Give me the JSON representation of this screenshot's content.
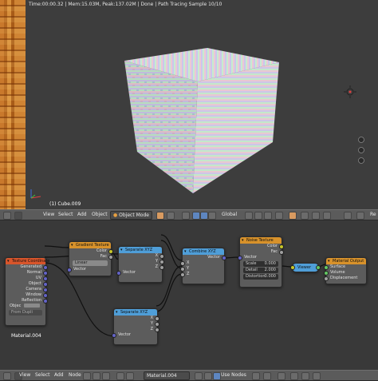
{
  "viewport": {
    "status": "Time:00:00.32 | Mem:15.03M, Peak:137.02M | Done | Path Tracing Sample 10/10",
    "object_name": "(1) Cube.009"
  },
  "viewport_header": {
    "menu_view": "View",
    "menu_select": "Select",
    "menu_add": "Add",
    "menu_object": "Object",
    "mode": "Object Mode",
    "orientation": "Global",
    "truncated": "Re"
  },
  "node_editor": {
    "material_label": "Material.004",
    "nodes": {
      "texcoord": {
        "title": "Texture Coordinate",
        "outputs": [
          "Generated",
          "Normal",
          "UV",
          "Object",
          "Camera",
          "Window",
          "Reflection"
        ],
        "object_label": "Objec",
        "from_dupli": "From Dupli"
      },
      "gradient": {
        "title": "Gradient Texture",
        "outputs": [
          "Color",
          "Fac"
        ],
        "type": "Linear",
        "input": "Vector"
      },
      "separate1": {
        "title": "Separate XYZ",
        "outputs": [
          "X",
          "Y",
          "Z"
        ],
        "input": "Vector"
      },
      "separate2": {
        "title": "Separate XYZ",
        "outputs": [
          "X",
          "Y",
          "Z"
        ],
        "input": "Vector"
      },
      "combine": {
        "title": "Combine XYZ",
        "output": "Vector",
        "inputs": [
          "X",
          "Y",
          "Z"
        ]
      },
      "noise": {
        "title": "Noise Texture",
        "outputs": [
          "Color",
          "Fac"
        ],
        "input": "Vector",
        "scale_label": "Scale",
        "scale_value": "0.000",
        "detail_label": "Detail",
        "detail_value": "2.000",
        "distortion_label": "Distortion",
        "distortion_value": "0.000"
      },
      "viewer": {
        "title": "Viewer"
      },
      "output": {
        "title": "Material Output",
        "inputs": [
          "Surface",
          "Volume",
          "Displacement"
        ]
      }
    }
  },
  "node_header": {
    "menu_view": "View",
    "menu_select": "Select",
    "menu_add": "Add",
    "menu_node": "Node",
    "material": "Material.004",
    "use_nodes": "Use Nodes"
  },
  "colors": {
    "input_header": "#d8552b",
    "texture_header": "#d8922b",
    "converter_header": "#4f9ed8",
    "output_header": "#d8922b",
    "viewer_header": "#4f9ed8"
  }
}
